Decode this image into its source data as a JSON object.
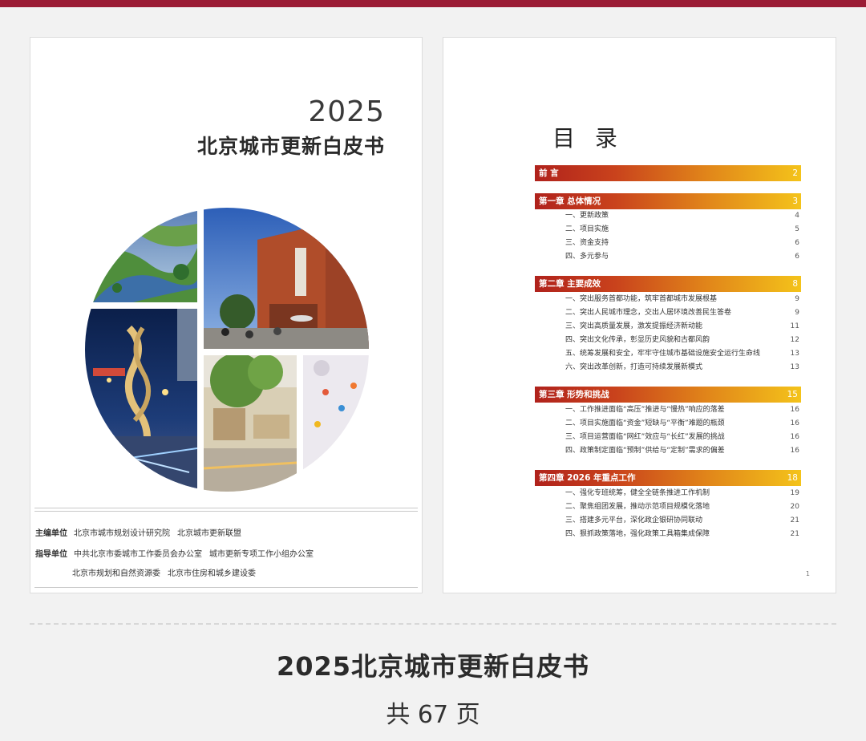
{
  "cover": {
    "year": "2025",
    "title": "北京城市更新白皮书",
    "editor_label": "主编单位",
    "editor_1": "北京市城市规划设计研究院",
    "editor_2": "北京城市更新联盟",
    "guide_label": "指导单位",
    "guide_1": "中共北京市委城市工作委员会办公室",
    "guide_2": "城市更新专项工作小组办公室",
    "guide_3": "北京市规划和自然资源委",
    "guide_4": "北京市住房和城乡建设委"
  },
  "toc": {
    "title": "目 录",
    "page_number": "1",
    "sections": [
      {
        "label": "前 言",
        "page": "2",
        "items": []
      },
      {
        "label": "第一章 总体情况",
        "page": "3",
        "items": [
          {
            "label": "一、更新政策",
            "page": "4"
          },
          {
            "label": "二、项目实施",
            "page": "5"
          },
          {
            "label": "三、资金支持",
            "page": "6"
          },
          {
            "label": "四、多元参与",
            "page": "6"
          }
        ]
      },
      {
        "label": "第二章 主要成效",
        "page": "8",
        "items": [
          {
            "label": "一、突出服务首都功能，筑牢首都城市发展根基",
            "page": "9"
          },
          {
            "label": "二、突出人民城市理念，交出人居环境改善民生答卷",
            "page": "9"
          },
          {
            "label": "三、突出高质量发展，激发提振经济新动能",
            "page": "11"
          },
          {
            "label": "四、突出文化传承，彰显历史风貌和古都风韵",
            "page": "12"
          },
          {
            "label": "五、统筹发展和安全，牢牢守住城市基础设施安全运行生命线",
            "page": "13"
          },
          {
            "label": "六、突出改革创新，打造可持续发展新模式",
            "page": "13"
          }
        ]
      },
      {
        "label": "第三章 形势和挑战",
        "page": "15",
        "items": [
          {
            "label": "一、工作推进面临“高压”推进与“慢热”响应的落差",
            "page": "16"
          },
          {
            "label": "二、项目实施面临“资金”短缺与“平衡”难题的瓶颈",
            "page": "16"
          },
          {
            "label": "三、项目运营面临“网红”效应与“长红”发展的挑战",
            "page": "16"
          },
          {
            "label": "四、政策制定面临“预制”供给与“定制”需求的偏差",
            "page": "16"
          }
        ]
      },
      {
        "label": "第四章 2026 年重点工作",
        "page": "18",
        "items": [
          {
            "label": "一、强化专班统筹，健全全链条推进工作机制",
            "page": "19"
          },
          {
            "label": "二、聚焦组团发展，推动示范项目规模化落地",
            "page": "20"
          },
          {
            "label": "三、搭建多元平台，深化政企银研协同联动",
            "page": "21"
          },
          {
            "label": "四、狠抓政策落地，强化政策工具箱集成保障",
            "page": "21"
          }
        ]
      }
    ]
  },
  "footer": {
    "title": "2025北京城市更新白皮书",
    "pages": "共 67 页"
  },
  "colors": {
    "top_bar": "#9b1c35",
    "gradient_start": "#b0221c",
    "gradient_end": "#f4c31a"
  }
}
